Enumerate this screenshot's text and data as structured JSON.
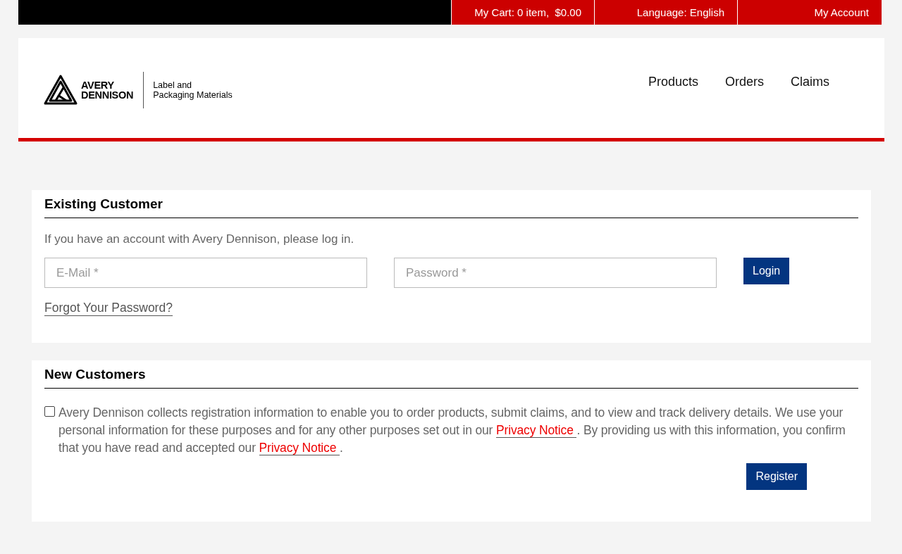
{
  "top_bar": {
    "cart": "My Cart: 0 item,  $0.00",
    "language": "Language: English",
    "account": "My Account"
  },
  "header": {
    "logo": {
      "brand": [
        "AVERY",
        "DENNISON"
      ],
      "tagline": [
        "Label and",
        "Packaging Materials"
      ]
    },
    "nav": [
      {
        "label": "Products"
      },
      {
        "label": "Orders"
      },
      {
        "label": "Claims"
      }
    ]
  },
  "existing_customer": {
    "title": "Existing Customer",
    "intro": "If you have an account with Avery Dennison, please log in.",
    "email": {
      "placeholder": "E-Mail *"
    },
    "password": {
      "placeholder": "Password *"
    },
    "login": "Login",
    "forgot": "Forgot Your Password?"
  },
  "new_customers": {
    "title": "New Customers",
    "consent": {
      "checked": false,
      "parts": [
        {
          "kind": "text",
          "text": "Avery Dennison collects registration information to enable you to order products, submit claims, and to view and track delivery details. We use your personal information for these purposes and for any other purposes set out in our "
        },
        {
          "kind": "link",
          "text": "Privacy Notice "
        },
        {
          "kind": "text",
          "text": ". By providing us with this information, you confirm that you have read and accepted our "
        },
        {
          "kind": "link",
          "text": "Privacy Notice "
        },
        {
          "kind": "text",
          "text": "."
        }
      ]
    },
    "register": "Register"
  }
}
